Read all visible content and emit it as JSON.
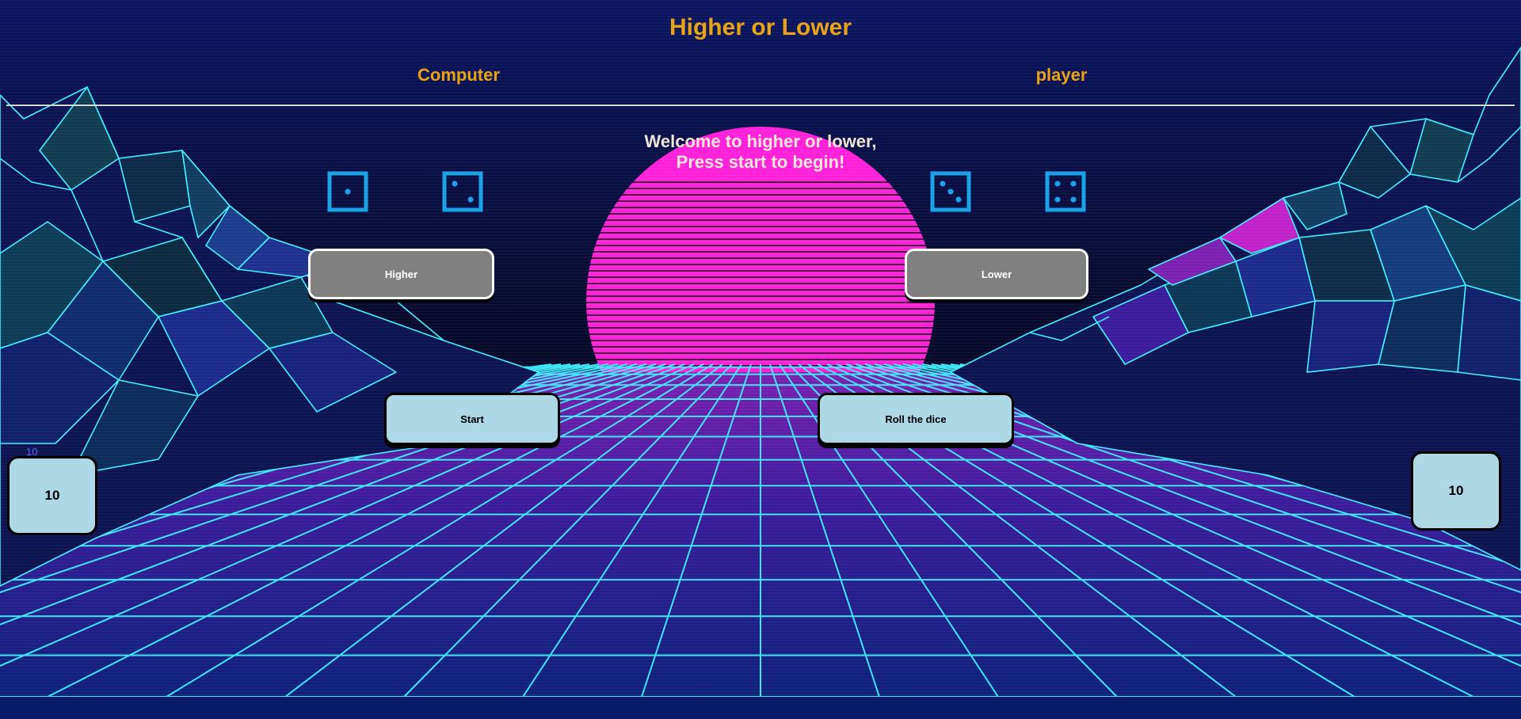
{
  "header": {
    "title": "Higher or Lower",
    "computer_label": "Computer",
    "player_label": "player"
  },
  "message": {
    "line1": "Welcome to higher or lower,",
    "line2": "Press start to begin!"
  },
  "dice": {
    "computer": [
      1,
      2
    ],
    "player": [
      3,
      4
    ]
  },
  "buttons": {
    "higher": "Higher",
    "lower": "Lower",
    "start": "Start",
    "roll": "Roll the dice"
  },
  "scores": {
    "computer_caption": "10",
    "computer": "10",
    "player": "10"
  },
  "colors": {
    "title": "#e8a317",
    "dice": "#1aa3e8",
    "grey_button": "#808080",
    "light_button": "#add8e6",
    "sun": "#ff1fd8",
    "grid": "#3ff0ff"
  }
}
